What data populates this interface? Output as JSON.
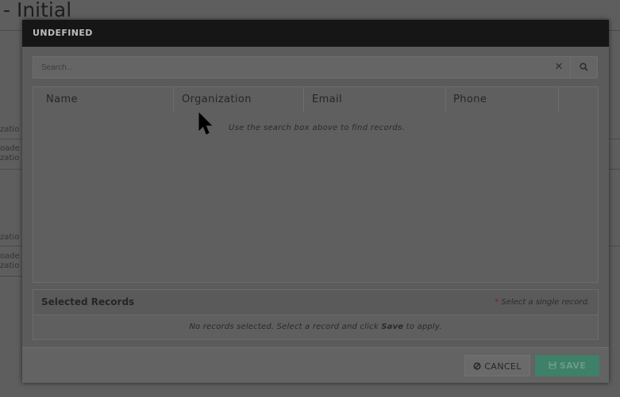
{
  "background": {
    "title_fragment": "- Initial",
    "side_fragments": [
      "zatio",
      "oade",
      "zatio",
      "zatio",
      "oade",
      "zatio"
    ]
  },
  "modal": {
    "title": "UNDEFINED",
    "search": {
      "placeholder": "Search...",
      "value": "",
      "clear_icon": "✕",
      "search_icon": "search-icon"
    },
    "results": {
      "columns": [
        "Name",
        "Organization",
        "Email",
        "Phone"
      ],
      "empty_message": "Use the search box above to find records."
    },
    "selected": {
      "title": "Selected Records",
      "required_mark": "*",
      "hint": "Select a single record.",
      "empty_prefix": "No records selected. Select a record and click",
      "empty_bold": "Save",
      "empty_suffix": "to apply."
    },
    "footer": {
      "cancel_label": "CANCEL",
      "save_label": "SAVE"
    }
  },
  "colors": {
    "header_bg": "#161616",
    "save_bg": "#3e8068",
    "overlay": "#5b5b5b"
  }
}
